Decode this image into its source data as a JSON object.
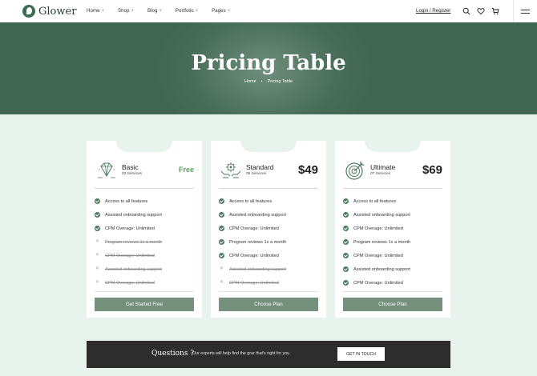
{
  "header": {
    "logo_text": "Glower",
    "nav": [
      {
        "label": "Home",
        "suffix": "+"
      },
      {
        "label": "Shop",
        "suffix": "+"
      },
      {
        "label": "Blog",
        "suffix": "+"
      },
      {
        "label": "Portfolio",
        "suffix": "+"
      },
      {
        "label": "Pages",
        "suffix": "+"
      }
    ],
    "login_label": "Login / Register",
    "icons": [
      "search-icon",
      "heart-icon",
      "cart-icon",
      "menu-icon"
    ]
  },
  "hero": {
    "title": "Pricing Table",
    "breadcrumb": [
      "Home",
      "Pricing Table"
    ],
    "breadcrumb_sep": "•"
  },
  "plans": [
    {
      "icon": "diamond-icon",
      "name": "Basic",
      "services": "03 Services",
      "price": "Free",
      "features": [
        {
          "text": "Access to all features",
          "included": true
        },
        {
          "text": "Assisted onboarding support",
          "included": true
        },
        {
          "text": "CPM Overage: Unlimited",
          "included": true
        },
        {
          "text": "Program reviews 1x a month",
          "included": false
        },
        {
          "text": "CPM Overage: Unlimited",
          "included": false
        },
        {
          "text": "Assisted onboarding support",
          "included": false
        },
        {
          "text": "CPM Overage: Unlimited",
          "included": false
        }
      ],
      "button": "Get Started Free"
    },
    {
      "icon": "hands-gear-icon",
      "name": "Standard",
      "services": "05 Services",
      "price": "$49",
      "features": [
        {
          "text": "Access to all features",
          "included": true
        },
        {
          "text": "Assisted onboarding support",
          "included": true
        },
        {
          "text": "CPM Overage: Unlimited",
          "included": true
        },
        {
          "text": "Program reviews 1x a month",
          "included": true
        },
        {
          "text": "CPM Overage: Unlimited",
          "included": true
        },
        {
          "text": "Assisted onboarding support",
          "included": false
        },
        {
          "text": "CPM Overage: Unlimited",
          "included": false
        }
      ],
      "button": "Choose Plan"
    },
    {
      "icon": "target-icon",
      "name": "Ultimate",
      "services": "07 Services",
      "price": "$69",
      "features": [
        {
          "text": "Access to all features",
          "included": true
        },
        {
          "text": "Assisted onboarding support",
          "included": true
        },
        {
          "text": "CPM Overage: Unlimited",
          "included": true
        },
        {
          "text": "Program reviews 1x a month",
          "included": true
        },
        {
          "text": "CPM Overage: Unlimited",
          "included": true
        },
        {
          "text": "Assisted onboarding support",
          "included": true
        },
        {
          "text": "CPM Overage: Unlimited",
          "included": true
        }
      ],
      "button": "Choose Plan"
    }
  ],
  "questions": {
    "title": "Questions ?",
    "text": "Our experts will help find the grar that's right for you",
    "button": "GET IN TOUCH"
  },
  "colors": {
    "accent": "#75907d",
    "hero": "#3f6650",
    "check": "#4c7a5f",
    "free_price": "#59a05a",
    "page_bg": "#e9f3ee",
    "dark_bar": "#2d2d2d"
  }
}
